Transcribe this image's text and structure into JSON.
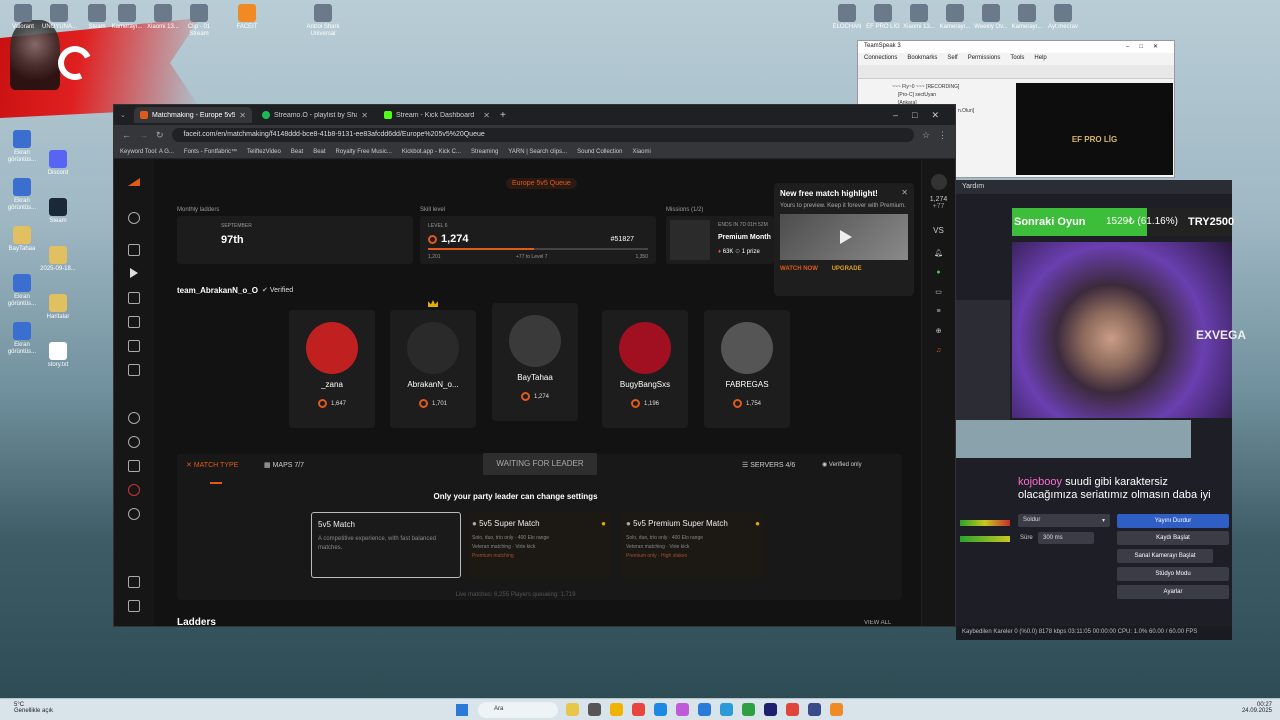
{
  "desktop": {
    "left_icons": [
      "Ekran görüntüs...",
      "Discord",
      "Ekran görüntüs...",
      "Steam",
      "BayTahaa",
      "2025-09-18...",
      "Ekran görüntüs...",
      "Haritalar",
      "Ekran görüntüs...",
      "story.txt"
    ],
    "top_icons": [
      "Valorant",
      "UNOYUNA...",
      "Steam",
      "Kamerayı...",
      "Xiaomi 13...",
      "Clip - 01 Stream",
      "FACEIT",
      "Antrol Shark Universal",
      "ELOCHAN",
      "EF PRO LİG",
      "Xiaomi 13...",
      "Kamerayı...",
      "Weekly Ov...",
      "Kamerayı...",
      "Ayt.mecrav"
    ]
  },
  "browser": {
    "tabs": [
      {
        "label": "Matchmaking - Europe 5v5 Qu...",
        "color": "#e05a1a"
      },
      {
        "label": "Streamo.O - playlist by Shape...",
        "color": "#1db954"
      },
      {
        "label": "Stream - Kick Dashboard",
        "color": "#53fc18"
      }
    ],
    "url": "faceit.com/en/matchmaking/f4148ddd-bce8-41b8-9131-ee83afcdd6dd/Europe%205v5%20Queue",
    "bookmarks": [
      "Keyword Tool: A G...",
      "Fonts - Fontfabric™",
      "TeliftezVideo",
      "Beat",
      "Beat",
      "Royalty Free Music...",
      "Kickbot.app - Kick C...",
      "Streaming",
      "YARN | Search clips...",
      "Sound Collection",
      "Xiaomi"
    ]
  },
  "faceit": {
    "queue_badge": "Europe 5v5 Queue",
    "monthly_leaders": {
      "label": "Monthly ladders",
      "month": "SEPTEMBER",
      "rank": "97th"
    },
    "skill": {
      "label": "Skill level",
      "level_label": "LEVEL 6",
      "elo": "1,274",
      "rank": "#51827",
      "min": "1,201",
      "to_next": "+77 to Level 7",
      "max": "1,350"
    },
    "missions": {
      "label": "Missions (1/2)",
      "ends": "ENDS IN 7D 01H 52M",
      "title": "Premium Month",
      "reward": "63K",
      "prize": "1 prize"
    },
    "team_name": "team_AbrakanN_o_O",
    "verified": "Verified",
    "players": [
      {
        "name": "_zana",
        "elo": "1,647",
        "color": "#c02020"
      },
      {
        "name": "AbrakanN_o...",
        "elo": "1,701",
        "color": "#2a2a2a"
      },
      {
        "name": "BayTahaa",
        "elo": "1,274",
        "color": "#3a3a3a"
      },
      {
        "name": "BugyBangSxs",
        "elo": "1,196",
        "color": "#a01020"
      },
      {
        "name": "FABREGAS",
        "elo": "1,754",
        "color": "#555555"
      }
    ],
    "tabs": {
      "match_type": "MATCH TYPE",
      "maps": "MAPS 7/7",
      "waiting": "WAITING FOR LEADER",
      "servers": "SERVERS 4/6",
      "verified_only": "Verified only"
    },
    "leader_note": "Only your party leader can change settings",
    "modes": [
      {
        "title": "5v5 Match",
        "desc": "A competitive experience, with fast balanced matches."
      },
      {
        "title": "5v5 Super Match",
        "f1": "Solo, duo, trio only",
        "f2": "400 Elo range",
        "f3": "Veteran matching",
        "f4": "Vote kick",
        "f5": "Premium matching"
      },
      {
        "title": "5v5 Premium Super Match",
        "f1": "Solo, duo, trio only",
        "f2": "400 Elo range",
        "f3": "Veteran matching",
        "f4": "Vote kick",
        "f5": "Premium only",
        "f6": "High stakes"
      }
    ],
    "live": "Live matches: 6,255    Players queueing: 1,719",
    "ladders": "Ladders",
    "view_all": "VIEW ALL",
    "right_elo": "1,274",
    "right_plus": "+77",
    "vs": "VS",
    "popup": {
      "title": "New free match highlight!",
      "desc": "Yours to preview. Keep it forever with Premium.",
      "watch": "WATCH NOW",
      "upgrade": "UPGRADE"
    }
  },
  "teamspeak": {
    "title": "TeamSpeak 3",
    "menu": [
      "Connections",
      "Bookmarks",
      "Self",
      "Permissions",
      "Tools",
      "Help"
    ],
    "channels": [
      "~~~ Fly~0 ~~~ [RECORDING]",
      "[Pro-C] sectUyan",
      "[Ankara]",
      "n.Olun]"
    ],
    "banner": "EF PRO LİG"
  },
  "overlay": {
    "next_game": "Sonraki Oyun",
    "progress_text": "1529₺ (61.16%)",
    "goal": "TRY2500",
    "progress": 0.6116,
    "webcam_text": "EXVEGA",
    "chat_user": "kojobooy",
    "chat_msg": "suudi gibi karaktersiz olacağımıza seriatımız olmasın daba iyi"
  },
  "obs": {
    "yardim": "Yardım",
    "stop_label": "Soldur",
    "duration_label": "Süre",
    "duration": "300 ms",
    "buttons": [
      "Yayını Durdur",
      "Kaydı Başlat",
      "Sanal Kamerayı Başlat",
      "Stüdyo Modu",
      "Ayarlar"
    ],
    "status": "Kaybedilen Kareler 0 (%0.0)    8178 kbps    03:11:05    00:00:00    CPU: 1.0%    60.00 / 60.00 FPS"
  },
  "taskbar": {
    "weather_temp": "5°C",
    "weather_desc": "Genellikle açık",
    "search": "Ara",
    "time": "00:27",
    "date": "24.09.2025"
  }
}
